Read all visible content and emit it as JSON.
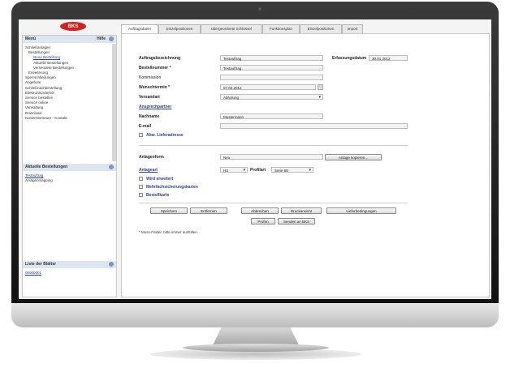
{
  "app": {
    "logo": "BKS"
  },
  "sidebar": {
    "menu_title": "Menü",
    "help_label": "Hilfe",
    "tree": [
      "Schließanlagen",
      "Bestellungen",
      "Neue Bestellung",
      "Aktuelle Bestellungen",
      "Versendete Bestellungen",
      "Erweiterung",
      "Sperrschließungen",
      "Angebote",
      "Schließnachbestellung",
      "Elektronikzubehör",
      "Service bestellen",
      "Service online",
      "Verwaltung",
      "Download",
      "Kundenbetreuer - Kontakt"
    ],
    "recent_title": "Aktuelle Bestellungen",
    "recent_items": [
      "Testauftrag",
      "Anlagenmapping"
    ],
    "sheets_title": "Liste der Blätter",
    "sheets_items": [
      "00000001"
    ]
  },
  "tabs": [
    {
      "label": "Auftragsdaten",
      "active": true
    },
    {
      "label": "Einzelpositionen",
      "active": false
    },
    {
      "label": "übergeordnete Schlüssel",
      "active": false
    },
    {
      "label": "Funktionsplan",
      "active": false
    },
    {
      "label": "Einzelpositionen",
      "active": false
    },
    {
      "label": "Import",
      "active": false
    }
  ],
  "form": {
    "auftrag_label": "Auftragsbezeichnung",
    "auftrag_value": "Testauftrag",
    "erfassung_label": "Erfassungsdatum",
    "erfassung_value": "30.01.2012",
    "bestell_label": "Bestellnummer *",
    "bestell_value": "Testauftrag",
    "kommission_label": "Kommission",
    "kommission_value": "",
    "wunsch_label": "Wunschtermin *",
    "wunsch_value": "07.02.2012",
    "versandart_label": "Versandart",
    "versandart_value": "Abholung",
    "ansprech_label": "Ansprechpartner",
    "nachname_label": "Nachname",
    "nachname_value": "Mustermann",
    "email_label": "E-mail",
    "email_value": "",
    "abw_label": "Abw. Lieferadresse",
    "anlage_label": "Anlagenform",
    "anlage_value": "Neu",
    "anlage_button": "Anlage kopieren...",
    "anlageart_label": "Anlageart",
    "anlageart_value": "HS",
    "profil_label": "Profilart",
    "profil_value": "Serie 50",
    "option1": "Wird erweitert",
    "option2": "Mehrfachsicherungskarten",
    "option3": "Bestellkarte",
    "buttons": [
      "Speichern",
      "Entfernen",
      "Abbrechen",
      "Druckansicht",
      "Lieferbedingungen"
    ],
    "buttons2": [
      "Prüfen",
      "Senden an BKS"
    ],
    "note": "* Muss-Felder, bitte immer ausfüllen"
  }
}
